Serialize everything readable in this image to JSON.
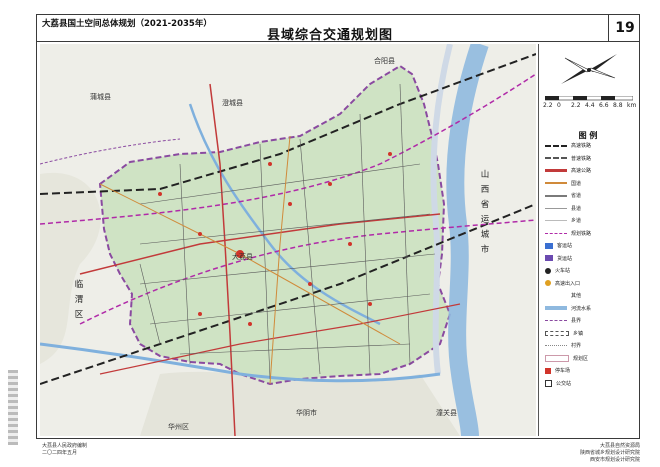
{
  "header": {
    "doc_title": "大荔县国土空间总体规划（2021-2035年）",
    "map_title": "县域综合交通规划图",
    "page_number": "19"
  },
  "map": {
    "places": {
      "heyang": "合阳县",
      "pucheng": "蒲城县",
      "chengcheng": "澄城县",
      "dali_city": "大荔县",
      "linwei": "临渭区",
      "huazhou": "华州区",
      "huayin": "华阴市",
      "tongguan": "潼关县",
      "shanxi": "山西省运城市"
    },
    "colors": {
      "county_fill": "#cfe3c4",
      "county_border": "#8a4aa0",
      "river": "#8fb9df",
      "railway": "#222222",
      "highway": "#c23a3a",
      "planned_rail": "#b02aa8"
    }
  },
  "compass": {
    "icon": "north-arrow-icon"
  },
  "scale_bar": {
    "ticks": [
      "2.2",
      "0",
      "2.2",
      "4.4",
      "6.6",
      "8.8"
    ],
    "unit": "km"
  },
  "legend": {
    "title": "图  例",
    "items": [
      "高速铁路",
      "普速铁路",
      "高速公路",
      "国道",
      "省道",
      "县道",
      "乡道",
      "规划铁路",
      "客运站",
      "货运站",
      "火车站",
      "高速出入口",
      "其他",
      "河流水系",
      "县界",
      "乡镇",
      "村界",
      "规划区",
      "停车场",
      "公交站"
    ]
  },
  "footer": {
    "left_lines": [
      "大荔县人民政府编制",
      "二〇二四年五月"
    ],
    "right_lines": [
      "大荔县自然资源局",
      "陕西省城乡规划设计研究院",
      "西安市规划设计研究院"
    ]
  }
}
